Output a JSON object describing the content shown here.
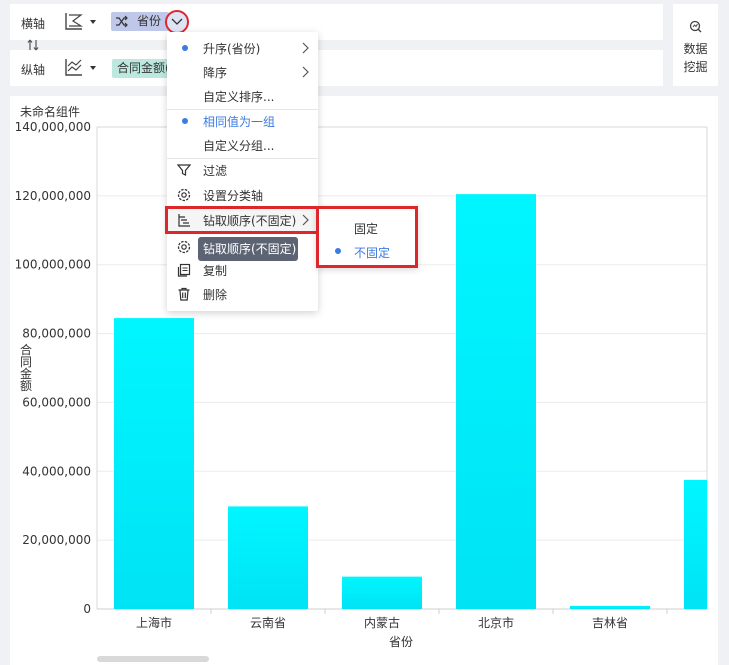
{
  "axes": {
    "x": {
      "label": "横轴",
      "field": "省份"
    },
    "y": {
      "label": "纵轴",
      "field": "合同金额("
    }
  },
  "mining": {
    "line1": "数据",
    "line2": "挖掘"
  },
  "panel": {
    "title": "未命名组件"
  },
  "menu": {
    "items": [
      {
        "label": "升序(省份)",
        "selected": true,
        "submenu": true
      },
      {
        "label": "降序",
        "selected": false,
        "submenu": true
      },
      {
        "label": "自定义排序...",
        "selected": false,
        "submenu": false
      },
      {
        "label": "相同值为一组",
        "selected": true,
        "submenu": false
      },
      {
        "label": "自定义分组...",
        "selected": false,
        "submenu": false
      },
      {
        "label": "过滤",
        "icon": "filter-icon"
      },
      {
        "label": "设置分类轴",
        "icon": "gear-icon"
      },
      {
        "label": "钻取顺序(不固定)",
        "icon": "drill-icon",
        "submenu": true
      },
      {
        "label": "",
        "icon": "gear-icon"
      },
      {
        "label": "复制",
        "icon": "copy-icon"
      },
      {
        "label": "删除",
        "icon": "trash-icon"
      }
    ],
    "tooltip": "钻取顺序(不固定)",
    "submenu": [
      {
        "label": "固定",
        "selected": false
      },
      {
        "label": "不固定",
        "selected": true
      }
    ]
  },
  "colors": {
    "accent": "#3d7be0",
    "highlight": "#e0262d",
    "bar_top": "#00f6ff",
    "bar_bottom": "#00e3f5"
  },
  "chart_data": {
    "type": "bar",
    "categories": [
      "上海市",
      "云南省",
      "内蒙古",
      "北京市",
      "吉林省",
      ""
    ],
    "values": [
      84500000,
      29800000,
      9400000,
      120500000,
      900000,
      37500000
    ],
    "xlabel": "省份",
    "ylabel": "合同金额",
    "ylim": [
      0,
      140000000
    ],
    "yticks": [
      0,
      20000000,
      40000000,
      60000000,
      80000000,
      100000000,
      120000000,
      140000000
    ],
    "ytick_labels": [
      "0",
      "20,000,000",
      "40,000,000",
      "60,000,000",
      "80,000,000",
      "100,000,000",
      "120,000,000",
      "140,000,000"
    ],
    "grid": true
  }
}
